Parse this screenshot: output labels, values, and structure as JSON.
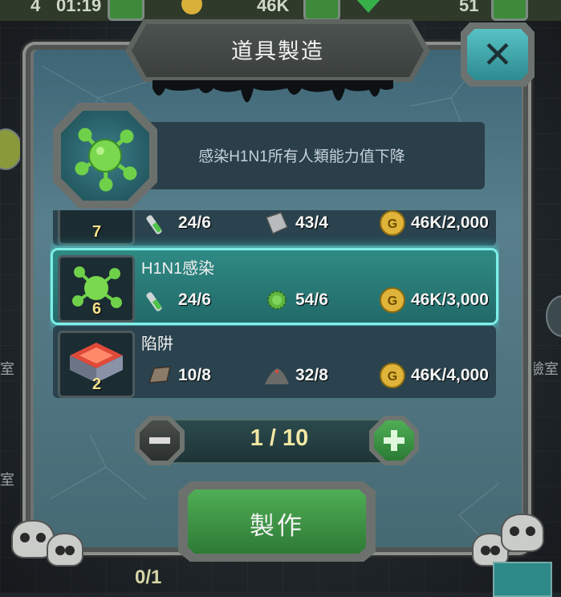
{
  "topbar": {
    "left_value": "4",
    "time": "01:19",
    "coins": "46K",
    "gems": "51"
  },
  "side_labels": {
    "left_top": "室",
    "left_bottom": "室",
    "right": "驗室"
  },
  "dialog": {
    "title": "道具製造",
    "close_icon": "close-icon",
    "selected": {
      "description": "感染H1N1所有人類能力值下降",
      "icon": "virus-icon"
    },
    "recipes": [
      {
        "name": "",
        "count": "7",
        "materials": [
          {
            "icon": "test-tube-icon",
            "value": "24/6"
          },
          {
            "icon": "metal-scrap-icon",
            "value": "43/4"
          },
          {
            "icon": "gold-coin-icon",
            "value": "46K/2,000"
          }
        ]
      },
      {
        "name": "H1N1感染",
        "count": "6",
        "selected": true,
        "materials": [
          {
            "icon": "test-tube-icon",
            "value": "24/6"
          },
          {
            "icon": "virus-icon",
            "value": "54/6"
          },
          {
            "icon": "gold-coin-icon",
            "value": "46K/3,000"
          }
        ]
      },
      {
        "name": "陷阱",
        "count": "2",
        "materials": [
          {
            "icon": "leather-icon",
            "value": "10/8"
          },
          {
            "icon": "dirt-pile-icon",
            "value": "32/8"
          },
          {
            "icon": "gold-coin-icon",
            "value": "46K/4,000"
          }
        ]
      }
    ],
    "quantity": "1 / 10",
    "make_button": "製作"
  },
  "bottom": {
    "progress": "0/1"
  },
  "colors": {
    "accent_teal": "#3fd6cf",
    "button_green": "#3d9a44",
    "coin_gold": "#e0b43a"
  }
}
